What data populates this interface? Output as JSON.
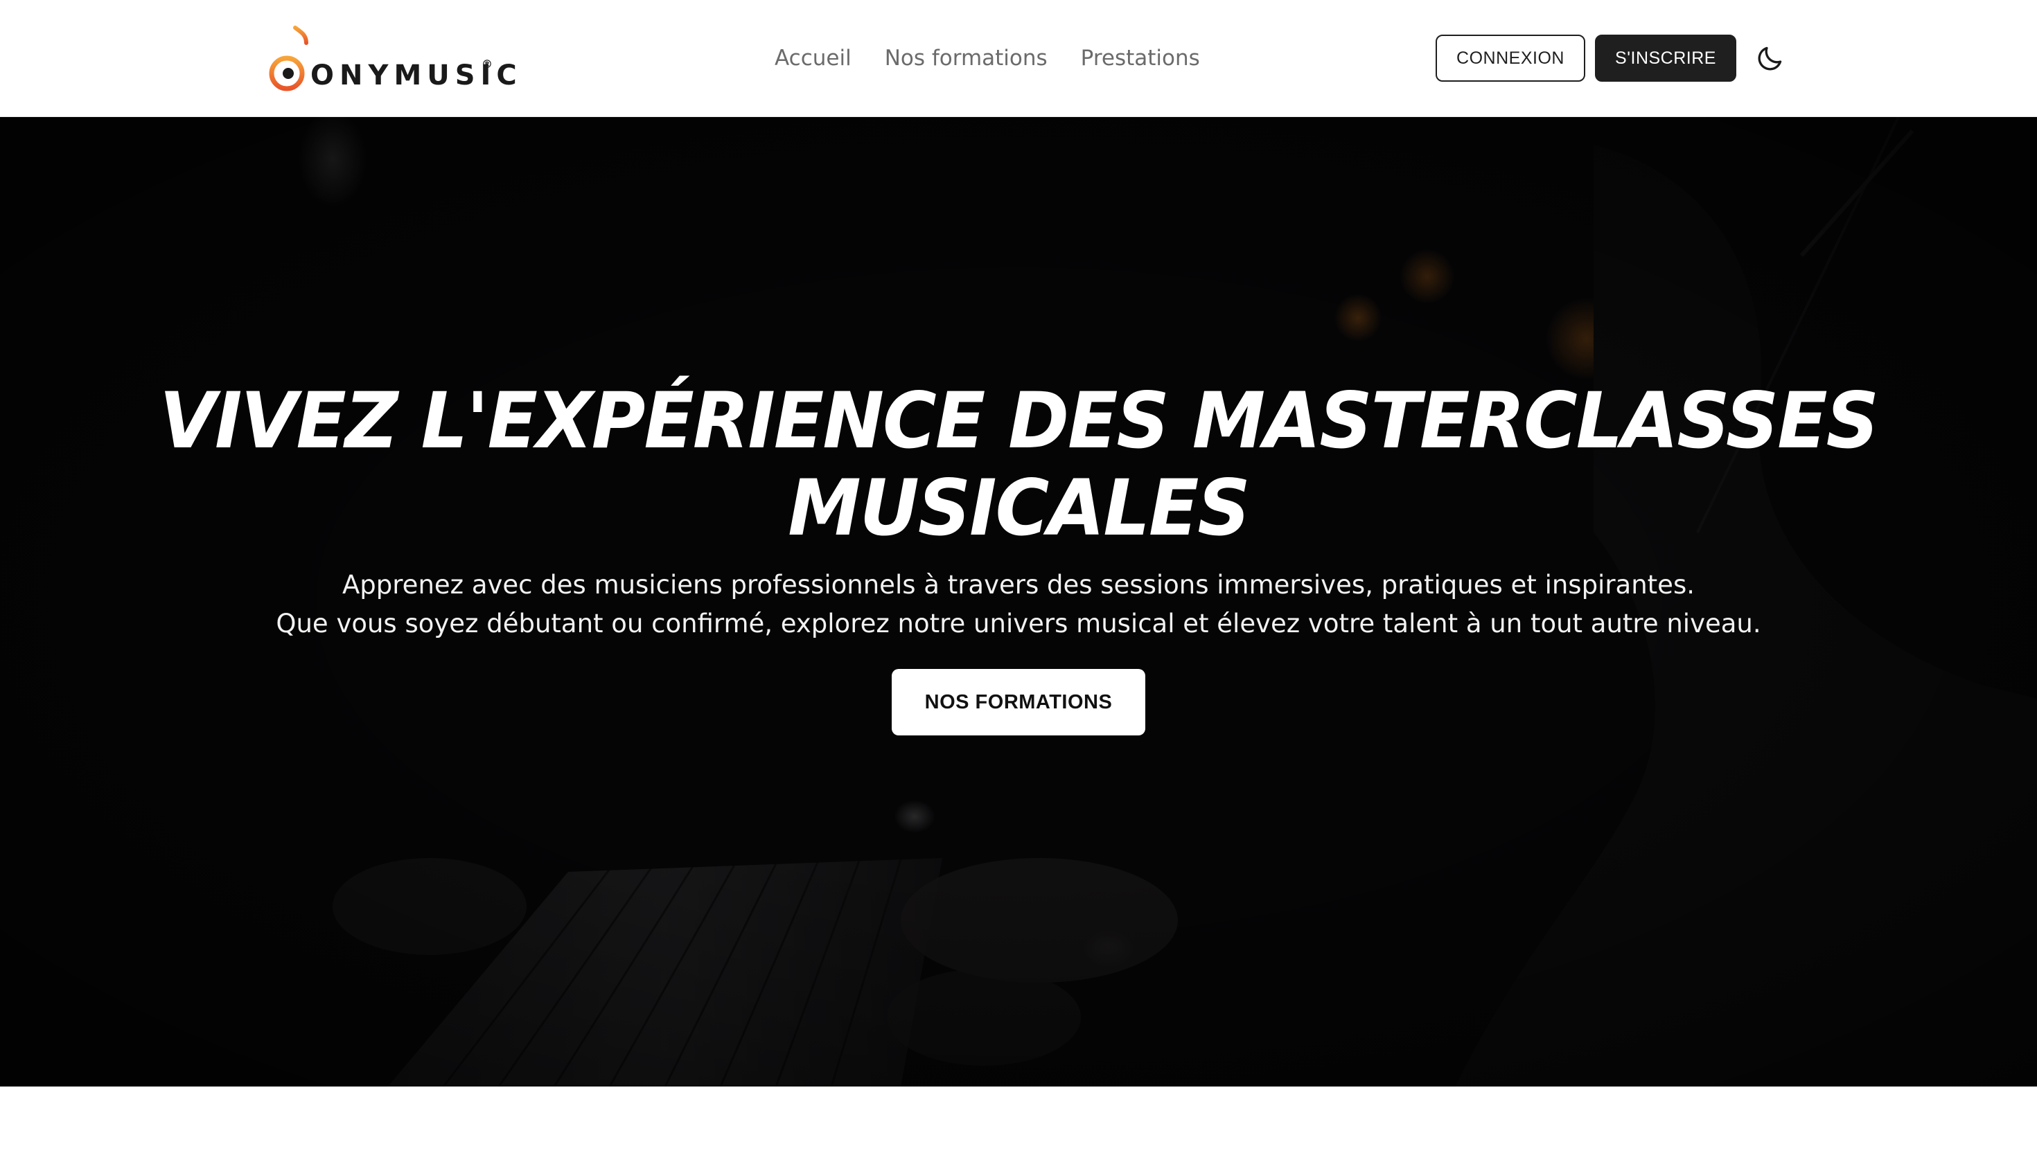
{
  "header": {
    "logo": {
      "text": "ONYMUSIC",
      "mark": "®",
      "icon": "music-note-d-icon",
      "accent_color": "#f07a2a"
    },
    "nav": [
      {
        "label": "Accueil"
      },
      {
        "label": "Nos formations"
      },
      {
        "label": "Prestations"
      }
    ],
    "login_label": "CONNEXION",
    "signup_label": "S'INSCRIRE",
    "theme_icon": "moon-icon"
  },
  "hero": {
    "title_line1": "Vivez l'expérience des masterclasses",
    "title_line2": "musicales",
    "subtitle_line1": "Apprenez avec des musiciens professionnels à travers des sessions immersives, pratiques et inspirantes.",
    "subtitle_line2": "Que vous soyez débutant ou confirmé, explorez notre univers musical et élevez votre talent à un tout autre niveau.",
    "cta_label": "NOS FORMATIONS",
    "background": "piano-performance-photo"
  }
}
